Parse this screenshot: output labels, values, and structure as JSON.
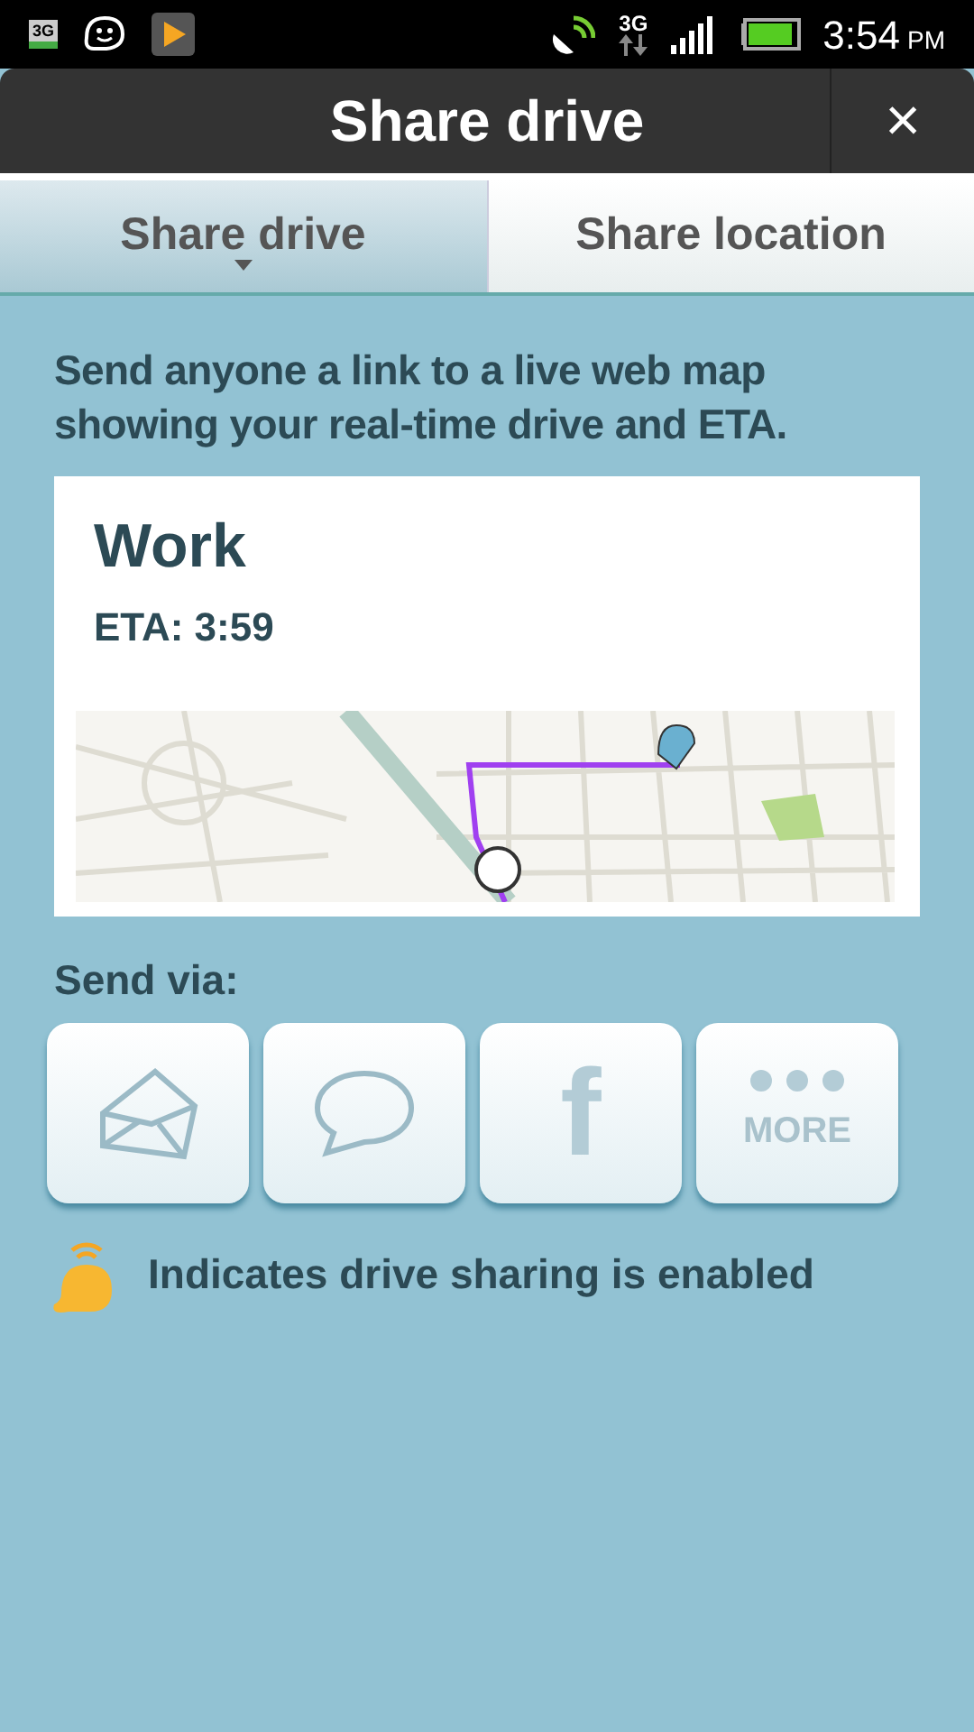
{
  "status_bar": {
    "notification_label": "3G",
    "network_label": "3G",
    "time": "3:54",
    "meridiem": "PM"
  },
  "title_bar": {
    "title": "Share drive",
    "close": "×"
  },
  "tabs": [
    {
      "label": "Share drive",
      "selected": true
    },
    {
      "label": "Share location",
      "selected": false
    }
  ],
  "description": "Send anyone a link to a live web map showing your real-time drive and ETA.",
  "destination_card": {
    "name": "Work",
    "eta": "ETA: 3:59"
  },
  "send_via": {
    "label": "Send via:",
    "options": [
      {
        "kind": "email"
      },
      {
        "kind": "message"
      },
      {
        "kind": "facebook",
        "glyph": "f"
      },
      {
        "kind": "more",
        "label": "MORE"
      }
    ]
  },
  "legend": "Indicates drive sharing is enabled"
}
